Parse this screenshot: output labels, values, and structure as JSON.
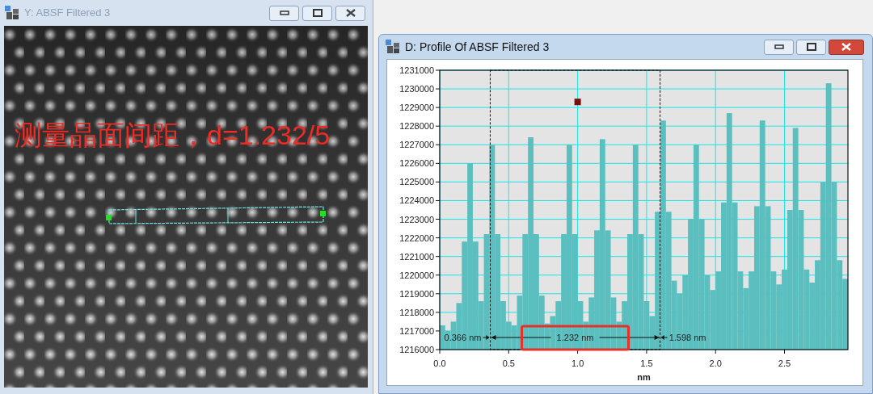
{
  "left_window": {
    "title": "Y: ABSF Filtered 3",
    "active": false,
    "image": {
      "kind": "picture",
      "annotation": "测量晶面间距，d=1.232/5"
    }
  },
  "right_window": {
    "title": "D: Profile Of ABSF Filtered 3",
    "active": true,
    "chart_data": {
      "type": "bar",
      "xlabel": "nm",
      "xlim": [
        0,
        2.96
      ],
      "ylim": [
        1216000,
        1231000
      ],
      "xticks": [
        {
          "value": 0,
          "label": "0.0"
        },
        {
          "value": 0.5,
          "label": "0.5"
        },
        {
          "value": 1,
          "label": "1.0"
        },
        {
          "value": 1.5,
          "label": "1.5"
        },
        {
          "value": 2,
          "label": "2.0"
        },
        {
          "value": 2.5,
          "label": "2.5"
        }
      ],
      "yticks": [
        1216000,
        1217000,
        1218000,
        1219000,
        1220000,
        1221000,
        1222000,
        1223000,
        1224000,
        1225000,
        1226000,
        1227000,
        1228000,
        1229000,
        1230000,
        1231000
      ],
      "grid": true,
      "x": [
        0.02,
        0.06,
        0.1,
        0.14,
        0.18,
        0.22,
        0.26,
        0.3,
        0.34,
        0.38,
        0.42,
        0.46,
        0.5,
        0.54,
        0.58,
        0.62,
        0.66,
        0.7,
        0.74,
        0.78,
        0.82,
        0.86,
        0.9,
        0.94,
        0.98,
        1.02,
        1.06,
        1.1,
        1.14,
        1.18,
        1.22,
        1.26,
        1.3,
        1.34,
        1.38,
        1.42,
        1.46,
        1.5,
        1.54,
        1.58,
        1.62,
        1.66,
        1.7,
        1.74,
        1.78,
        1.82,
        1.86,
        1.9,
        1.94,
        1.98,
        2.02,
        2.06,
        2.1,
        2.14,
        2.18,
        2.22,
        2.26,
        2.3,
        2.34,
        2.38,
        2.42,
        2.46,
        2.5,
        2.54,
        2.58,
        2.62,
        2.66,
        2.7,
        2.74,
        2.78,
        2.82,
        2.86,
        2.9,
        2.94
      ],
      "series": [
        {
          "color": "#5bbfbf",
          "values": [
            1217300,
            1217000,
            1217500,
            1218500,
            1221800,
            1226000,
            1221800,
            1218600,
            1222200,
            1227000,
            1222200,
            1218600,
            1217500,
            1217300,
            1218900,
            1222200,
            1227400,
            1222200,
            1218900,
            1217400,
            1217800,
            1218600,
            1222200,
            1227000,
            1222200,
            1218600,
            1217500,
            1218800,
            1222400,
            1227300,
            1222400,
            1218800,
            1217500,
            1218600,
            1222200,
            1227000,
            1222200,
            1218600,
            1217800,
            1223400,
            1228300,
            1223400,
            1219700,
            1219000,
            1220000,
            1223000,
            1227000,
            1223000,
            1220000,
            1219200,
            1220200,
            1223900,
            1228700,
            1223900,
            1220200,
            1219300,
            1220200,
            1223700,
            1228300,
            1223700,
            1220200,
            1219500,
            1220300,
            1223500,
            1227900,
            1223500,
            1220300,
            1219600,
            1220800,
            1225000,
            1230300,
            1225000,
            1220800,
            1219800
          ]
        }
      ],
      "annotations": [
        {
          "text": "0.366 nm",
          "x": 0.366,
          "y": 1216650
        },
        {
          "text": "1.232 nm",
          "x": 0.982,
          "y": 1216650
        },
        {
          "text": "1.598 nm",
          "x": 1.598,
          "y": 1216650
        }
      ]
    }
  }
}
